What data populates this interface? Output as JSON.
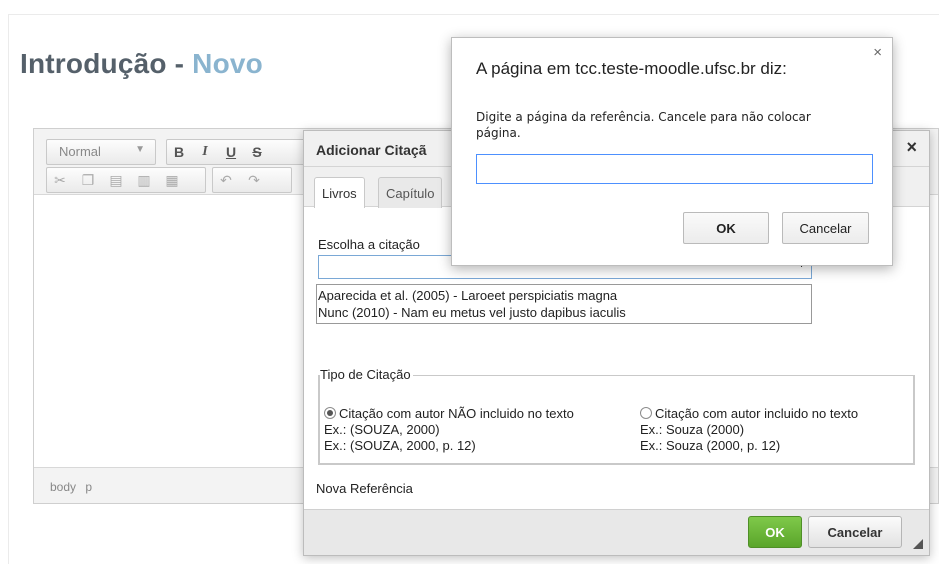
{
  "page": {
    "title_main": "Introdução - ",
    "title_accent": "Novo"
  },
  "editor": {
    "format_select": "Normal",
    "buttons": {
      "bold": "B",
      "italic": "I",
      "underline": "U",
      "strike": "S"
    },
    "icons": [
      "cut-icon",
      "copy-icon",
      "paste-icon",
      "paste-text-icon",
      "paste-word-icon",
      "undo-icon",
      "redo-icon"
    ],
    "statusbar": [
      "body",
      "p"
    ]
  },
  "citation_dialog": {
    "title": "Adicionar Citaçã",
    "tabs": [
      "Livros",
      "Capítulo"
    ],
    "choose_label": "Escolha a citação",
    "input_value": "",
    "input_marker": ".",
    "suggestions": [
      "Aparecida et al. (2005) - Laroeet perspiciatis magna",
      "Nunc (2010) - Nam eu metus vel justo dapibus iaculis"
    ],
    "citation_type": {
      "legend": "Tipo de Citação",
      "options": [
        {
          "label": "Citação com autor NÃO incluido no texto",
          "example1": "Ex.: (SOUZA, 2000)",
          "example2": "Ex.: (SOUZA, 2000, p. 12)",
          "checked": true
        },
        {
          "label": "Citação com autor incluido no texto",
          "example1": "Ex.: Souza (2000)",
          "example2": "Ex.: Souza (2000, p. 12)",
          "checked": false
        }
      ]
    },
    "new_reference": "Nova Referência",
    "ok_label": "OK",
    "cancel_label": "Cancelar",
    "close_symbol": "×"
  },
  "prompt_dialog": {
    "title": "A página em tcc.teste-moodle.ufsc.br diz:",
    "message": "Digite a página da referência. Cancele para não colocar página.",
    "input_value": "",
    "ok_label": "OK",
    "cancel_label": "Cancelar",
    "close_symbol": "×"
  }
}
